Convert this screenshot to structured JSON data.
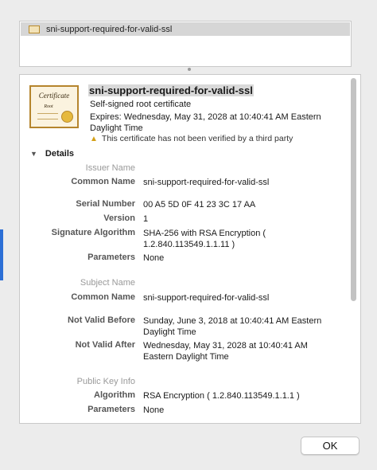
{
  "certificate_list": {
    "selected_item": {
      "label": "sni-support-required-for-valid-ssl",
      "icon": "certificate-icon"
    }
  },
  "certificate": {
    "name": "sni-support-required-for-valid-ssl",
    "type": "Self-signed root certificate",
    "expires": "Expires: Wednesday, May 31, 2028 at 10:40:41 AM Eastern Daylight Time",
    "warning": "This certificate has not been verified by a third party",
    "icon_title": "Certificate",
    "icon_subtitle": "Root"
  },
  "details": {
    "toggle_label": "Details",
    "issuer_name_header": "Issuer Name",
    "issuer_common_name_label": "Common Name",
    "issuer_common_name": "sni-support-required-for-valid-ssl",
    "serial_number_label": "Serial Number",
    "serial_number": "00 A5 5D 0F 41 23 3C 17 AA",
    "version_label": "Version",
    "version": "1",
    "signature_algorithm_label": "Signature Algorithm",
    "signature_algorithm": "SHA-256 with RSA Encryption ( 1.2.840.113549.1.1.11 )",
    "parameters_label": "Parameters",
    "parameters": "None",
    "subject_name_header": "Subject Name",
    "subject_common_name_label": "Common Name",
    "subject_common_name": "sni-support-required-for-valid-ssl",
    "not_valid_before_label": "Not Valid Before",
    "not_valid_before": "Sunday, June 3, 2018 at 10:40:41 AM Eastern Daylight Time",
    "not_valid_after_label": "Not Valid After",
    "not_valid_after": "Wednesday, May 31, 2028 at 10:40:41 AM Eastern Daylight Time",
    "public_key_info_header": "Public Key Info",
    "algorithm_label": "Algorithm",
    "algorithm": "RSA Encryption ( 1.2.840.113549.1.1.1 )",
    "pk_parameters_label": "Parameters",
    "pk_parameters": "None"
  },
  "buttons": {
    "ok_label": "OK"
  },
  "colors": {
    "warning_icon": "#d4a017",
    "selection_bg": "#d6d6d6",
    "accent_edge": "#2c6fd6"
  }
}
